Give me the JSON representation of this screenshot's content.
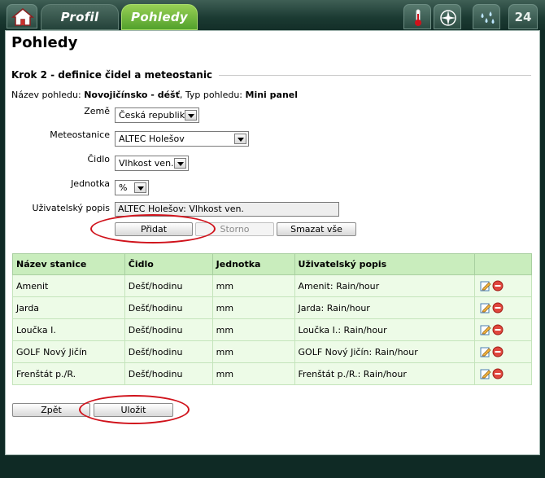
{
  "nav": {
    "tabs": [
      {
        "label": "Profil",
        "active": false
      },
      {
        "label": "Pohledy",
        "active": true
      }
    ],
    "icons": [
      "home-icon",
      "thermometer-icon",
      "compass-icon",
      "rain-drops-icon",
      "24h-icon"
    ],
    "hours_label": "24"
  },
  "page": {
    "title": "Pohledy",
    "section_title": "Krok 2 - definice čidel a meteostanic",
    "view_name_label": "Název pohledu:",
    "view_name": "Novojičínsko - déšť",
    "view_type_label": ", Typ pohledu:",
    "view_type": "Mini panel"
  },
  "form": {
    "country_label": "Země",
    "country_value": "Česká republika",
    "station_label": "Meteostanice",
    "station_value": "ALTEC Holešov",
    "sensor_label": "Čidlo",
    "sensor_value": "Vlhkost ven.",
    "unit_label": "Jednotka",
    "unit_value": "%",
    "desc_label": "Uživatelský popis",
    "desc_value": "ALTEC Holešov: Vlhkost ven.",
    "add_button": "Přidat",
    "cancel_button": "Storno",
    "clear_all_button": "Smazat vše"
  },
  "table": {
    "columns": [
      "Název stanice",
      "Čidlo",
      "Jednotka",
      "Uživatelský popis",
      ""
    ],
    "rows": [
      {
        "station": "Amenit",
        "sensor": "Dešť/hodinu",
        "unit": "mm",
        "desc": "Amenit: Rain/hour"
      },
      {
        "station": "Jarda",
        "sensor": "Dešť/hodinu",
        "unit": "mm",
        "desc": "Jarda: Rain/hour"
      },
      {
        "station": "Loučka I.",
        "sensor": "Dešť/hodinu",
        "unit": "mm",
        "desc": "Loučka I.: Rain/hour"
      },
      {
        "station": "GOLF Nový Jičín",
        "sensor": "Dešť/hodinu",
        "unit": "mm",
        "desc": "GOLF Nový Jičín: Rain/hour"
      },
      {
        "station": "Frenštát p./R.",
        "sensor": "Dešť/hodinu",
        "unit": "mm",
        "desc": "Frenštát p./R.: Rain/hour"
      }
    ]
  },
  "footer": {
    "back_button": "Zpět",
    "save_button": "Uložit"
  },
  "colors": {
    "highlight": "#d0121b",
    "active_tab": "#6fb83b",
    "table_header": "#c9edbd",
    "table_row": "#edfbe7"
  }
}
